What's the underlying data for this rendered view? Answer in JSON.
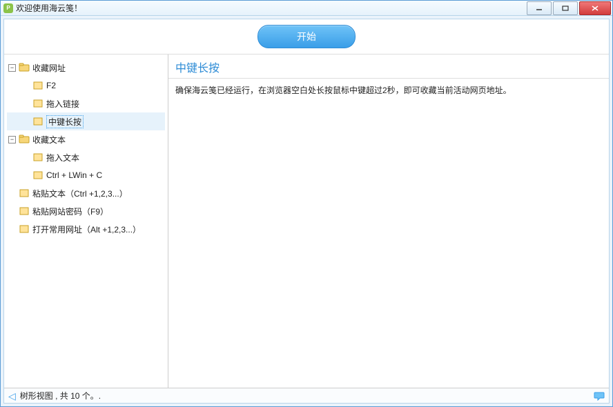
{
  "window": {
    "title": "欢迎使用海云笺！"
  },
  "start_button": "开始",
  "tree": {
    "items": [
      {
        "label": "收藏网址",
        "type": "folder-open",
        "expandable": true,
        "expanded": true,
        "children": [
          {
            "label": "F2",
            "type": "item"
          },
          {
            "label": "拖入链接",
            "type": "item"
          },
          {
            "label": "中键长按",
            "type": "item",
            "selected": true
          }
        ]
      },
      {
        "label": "收藏文本",
        "type": "folder-open",
        "expandable": true,
        "expanded": true,
        "children": [
          {
            "label": "拖入文本",
            "type": "item"
          },
          {
            "label": "Ctrl + LWin + C",
            "type": "item"
          }
        ]
      },
      {
        "label": "粘贴文本（Ctrl +1,2,3...）",
        "type": "item"
      },
      {
        "label": "粘贴网站密码（F9）",
        "type": "item"
      },
      {
        "label": "打开常用网址（Alt +1,2,3...）",
        "type": "item"
      }
    ]
  },
  "content": {
    "title": "中键长按",
    "body": "确保海云笺已经运行，在浏览器空白处长按鼠标中键超过2秒，即可收藏当前活动网页地址。"
  },
  "statusbar": {
    "text": "树形视图 , 共 10 个。."
  }
}
